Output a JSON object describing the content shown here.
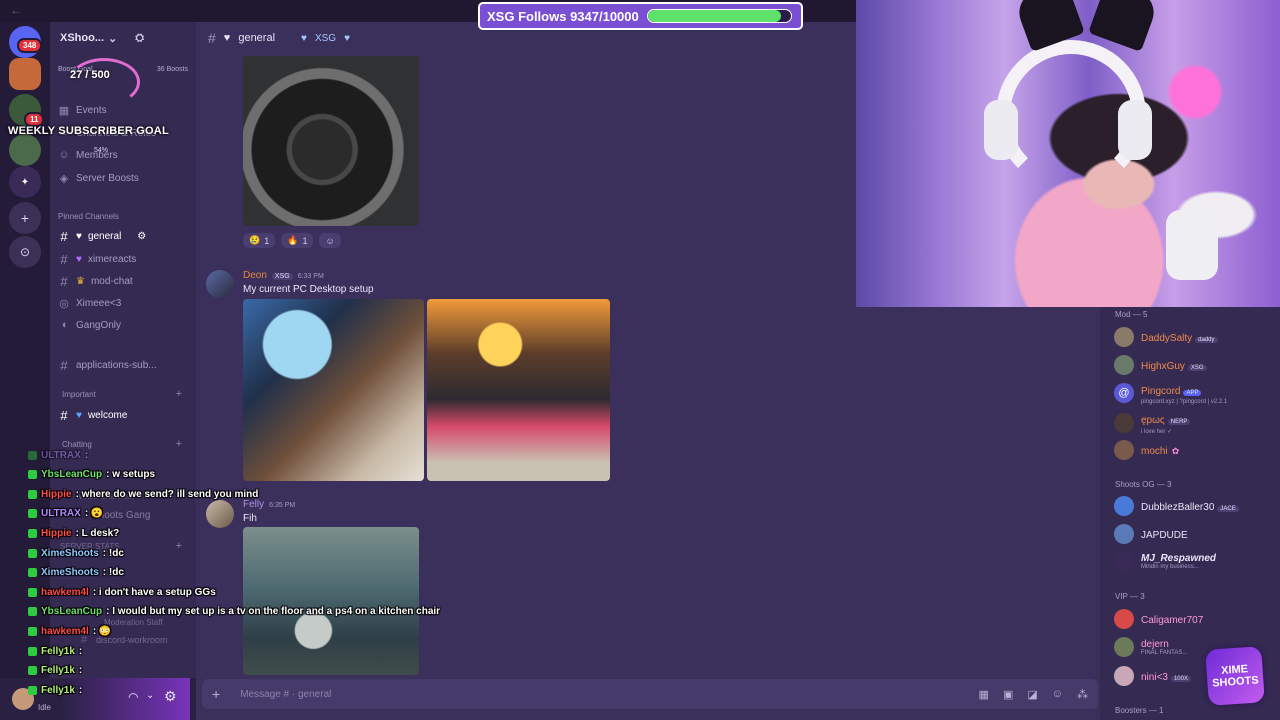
{
  "overlay": {
    "follow_goal_label": "XSG Follows 9347/10000",
    "follow_goal_fraction": 0.9347,
    "sub_goal_count": "27 / 500",
    "sub_goal_title": "WEEKLY SUBSCRIBER GOAL",
    "sub_goal_percent": "54%",
    "logo_text": "XIME SHOOTS"
  },
  "rail": {
    "discord_badge": "348",
    "server_badge": "11"
  },
  "sidebar": {
    "guild_name": "XShoo...",
    "boost_left": "Boost Goal",
    "boost_right": "36 Boosts",
    "items": [
      {
        "label": "Events",
        "icon": "calendar-icon"
      },
      {
        "label": "Channels & Roles",
        "icon": "list-icon"
      },
      {
        "label": "Members",
        "icon": "members-icon"
      },
      {
        "label": "Server Boosts",
        "icon": "boost-icon"
      }
    ],
    "pinned_label": "Pinned Channels",
    "channels": [
      {
        "label": "general",
        "icon": "#",
        "active": true
      },
      {
        "label": "ximereacts",
        "icon": "#"
      },
      {
        "label": "mod-chat",
        "icon": "#"
      },
      {
        "label": "Ximeee<3",
        "icon": "stage"
      },
      {
        "label": "GangOnly",
        "icon": "voice"
      },
      {
        "label": "applications-sub...",
        "icon": "#"
      }
    ],
    "cat_important": "Important",
    "welcome": "welcome",
    "cat_chatting": "Chatting",
    "cat_voice": "Voice Channels",
    "voice_shoots": "Shoots Gang",
    "cat_server_stats": "SERVER STATS",
    "cat_mod_staff": "Moderation Staff",
    "discord_workroom": "discord-workroom",
    "user_status": "Idle"
  },
  "chat": {
    "channel_name": "general",
    "channel_tag": "XSG",
    "reactions": [
      {
        "emoji": "😢",
        "count": "1"
      },
      {
        "emoji": "🔥",
        "count": "1"
      }
    ],
    "messages": [
      {
        "author": "Deon",
        "author_color": "#e8883a",
        "tag": "XSG",
        "time": "6:33 PM",
        "text": "My current PC Desktop setup"
      },
      {
        "author": "Felly",
        "author_color": "#b08fe6",
        "time": "6:35 PM",
        "text": "Fih"
      }
    ],
    "composer_placeholder": "Message # · general"
  },
  "members": {
    "categories": [
      {
        "label": "Mod — 5"
      },
      {
        "label": "Shoots OG — 3"
      },
      {
        "label": "VIP — 3"
      },
      {
        "label": "Boosters — 1"
      }
    ],
    "mods": [
      {
        "name": "DaddySalty",
        "tag": "daddy",
        "color": "#f08a4a",
        "sub": ""
      },
      {
        "name": "HighxGuy",
        "tag": "XSG",
        "color": "#f08a4a",
        "sub": ""
      },
      {
        "name": "Pingcord",
        "tag": "APP",
        "color": "#f08a4a",
        "sub": "pingcord.xyz | ?pingcord | v2.2.1"
      },
      {
        "name": "ępως",
        "tag": "NERP",
        "color": "#f08a4a",
        "sub": "i love her ✓"
      },
      {
        "name": "mochi",
        "tag": "",
        "color": "#f08a4a",
        "sub": ""
      }
    ],
    "og": [
      {
        "name": "DubblezBaller30",
        "tag": "JACE",
        "color": "#e9e4f7",
        "sub": ""
      },
      {
        "name": "JAPDUDE",
        "tag": "",
        "color": "#e9e4f7",
        "sub": ""
      },
      {
        "name": "MJ_Respawned",
        "tag": "",
        "color": "#e9e4f7",
        "sub": "Mindin my business..."
      }
    ],
    "vip": [
      {
        "name": "Caligamer707",
        "tag": "",
        "color": "#ff9ad6",
        "sub": ""
      },
      {
        "name": "dejern",
        "tag": "",
        "color": "#ff9ad6",
        "sub": "FINAL FANTAS..."
      },
      {
        "name": "nini<3",
        "tag": "100X",
        "color": "#ff9ad6",
        "sub": ""
      }
    ]
  },
  "stream_chat": [
    {
      "name": "ULTRAX",
      "name_color": "#b38cff",
      "text": ": ",
      "faded": true
    },
    {
      "name": "YbsLeanCup",
      "name_color": "#6fe06a",
      "text": ": w setups"
    },
    {
      "name": "Hippie",
      "name_color": "#ff4b4b",
      "text": ": where do we send? ill send you mind"
    },
    {
      "name": "ULTRAX",
      "name_color": "#b38cff",
      "text": ": 😮"
    },
    {
      "name": "Hippie",
      "name_color": "#ff4b4b",
      "text": ": L desk?"
    },
    {
      "name": "XimeShoots",
      "name_color": "#8fc8ff",
      "text": ": !dc"
    },
    {
      "name": "XimeShoots",
      "name_color": "#8fc8ff",
      "text": ": !dc"
    },
    {
      "name": "hawkem4l",
      "name_color": "#ff4b4b",
      "text": ": i don't have a setup GGs"
    },
    {
      "name": "YbsLeanCup",
      "name_color": "#6fe06a",
      "text": ": I would but my set up is a tv on the floor and a ps4 on a kitchen chair"
    },
    {
      "name": "hawkem4l",
      "name_color": "#ff4b4b",
      "text": ": 😳"
    },
    {
      "name": "Felly1k",
      "name_color": "#b3f07a",
      "text": ": "
    },
    {
      "name": "Felly1k",
      "name_color": "#b3f07a",
      "text": ": "
    },
    {
      "name": "Felly1k",
      "name_color": "#b3f07a",
      "text": ": "
    }
  ],
  "colors": {
    "accent": "#7a4fd4",
    "progress": "#5fe06a",
    "mention_red": "#e0323a"
  }
}
